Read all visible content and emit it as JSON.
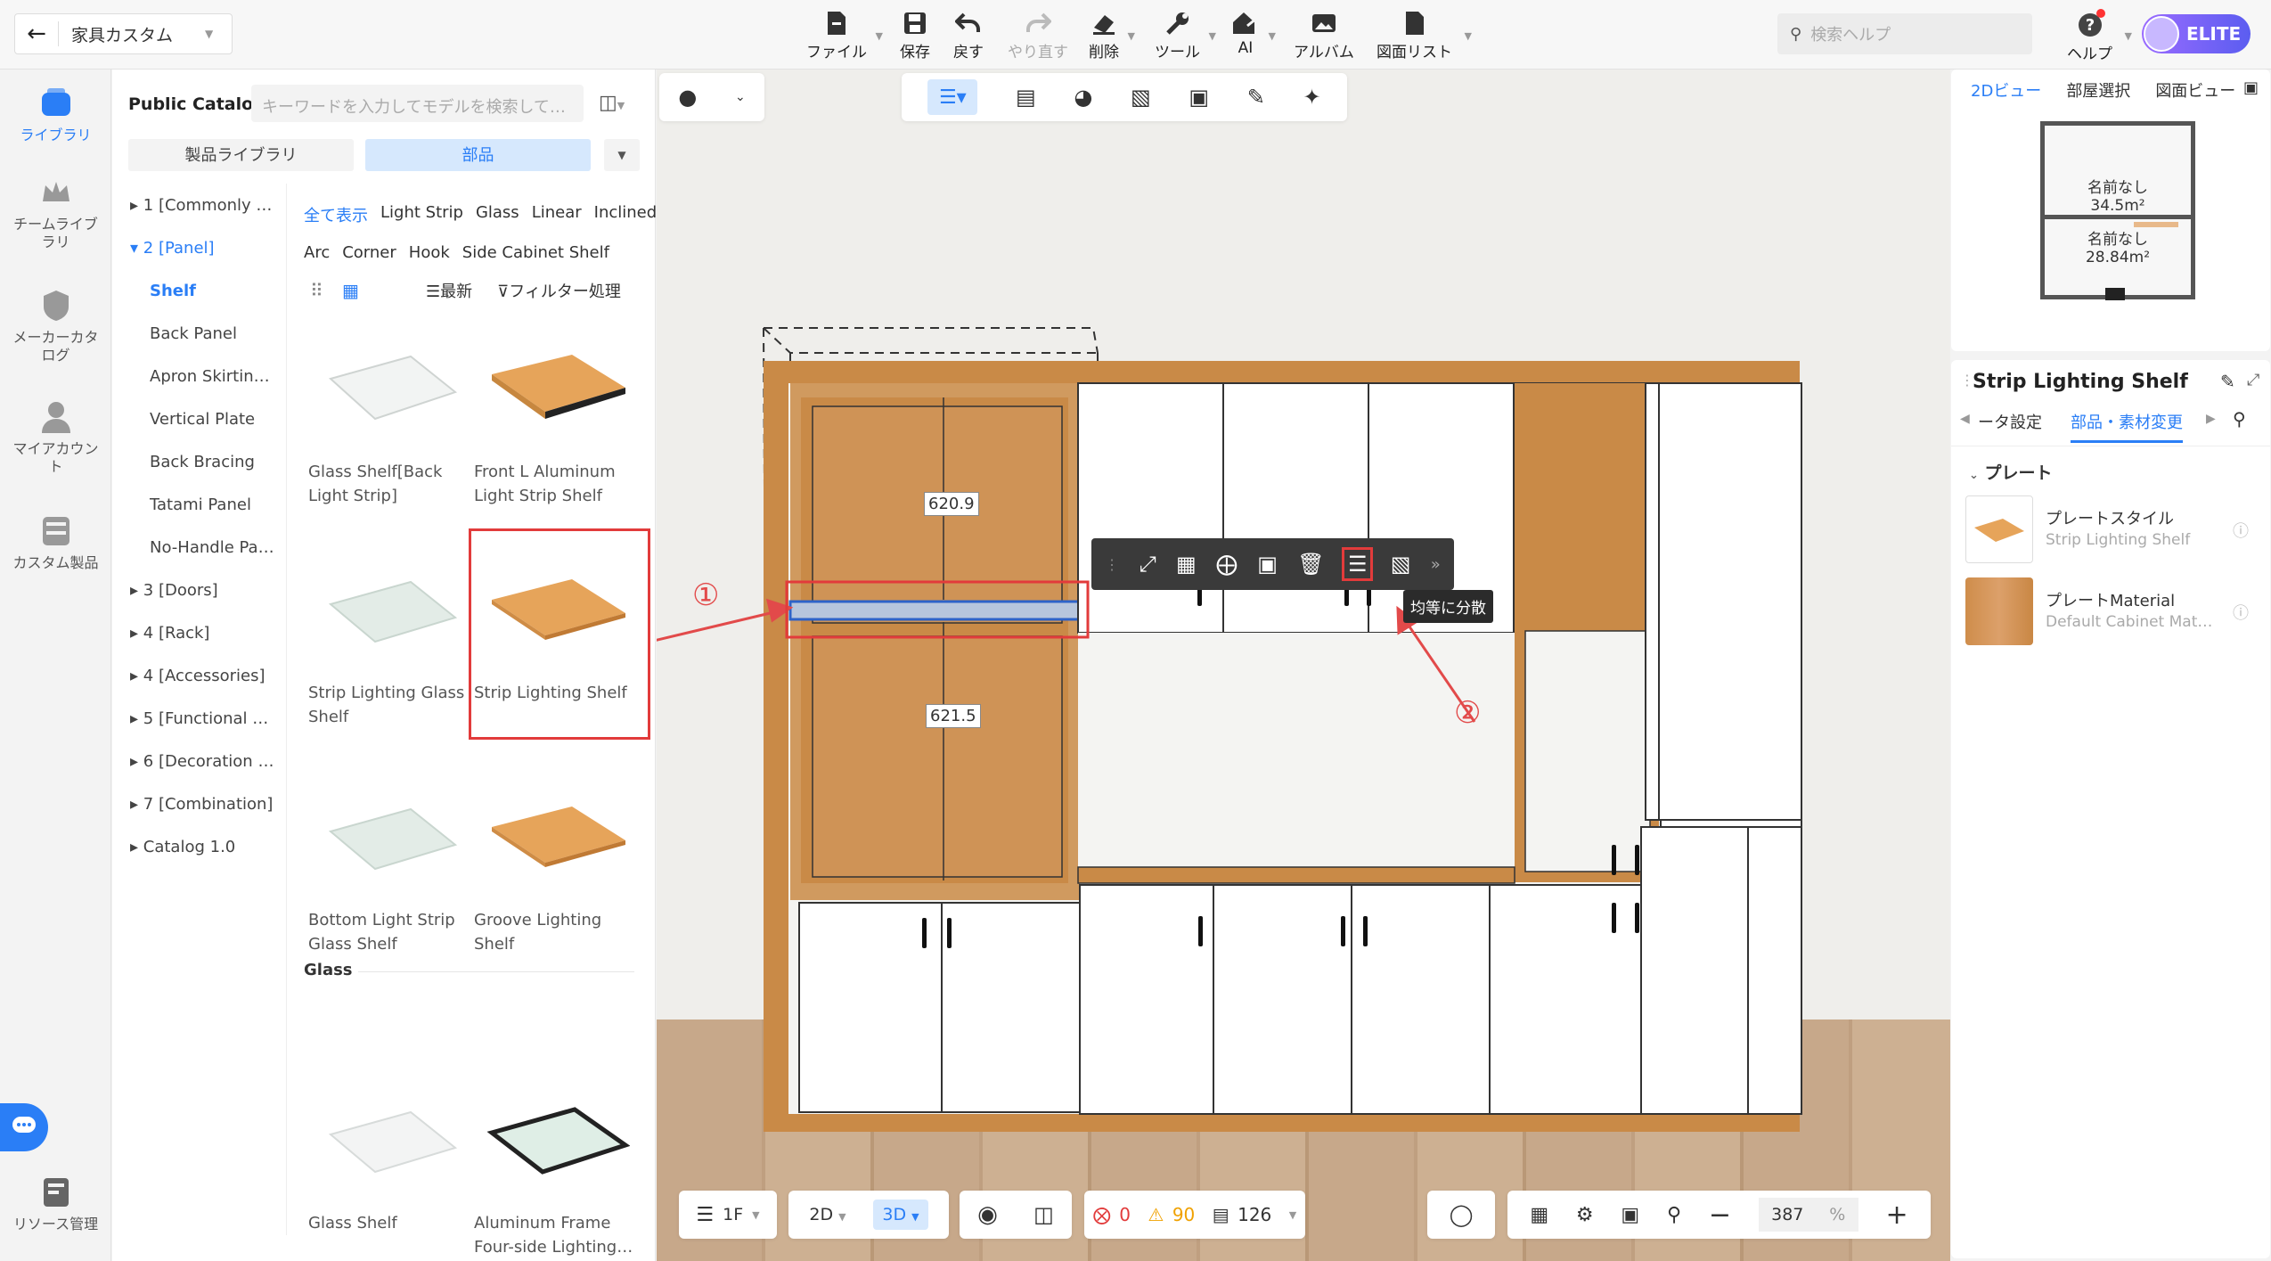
{
  "header": {
    "project_name": "家具カスタム",
    "toolbar": [
      {
        "label": "ファイル",
        "icon": "file-icon",
        "has_dropdown": true
      },
      {
        "label": "保存",
        "icon": "save-icon"
      },
      {
        "label": "戻す",
        "icon": "undo-icon"
      },
      {
        "label": "やり直す",
        "icon": "redo-icon",
        "disabled": true
      },
      {
        "label": "削除",
        "icon": "eraser-icon",
        "has_dropdown": true
      },
      {
        "label": "ツール",
        "icon": "wrench-icon",
        "has_dropdown": true
      },
      {
        "label": "AI",
        "icon": "ai-house-icon",
        "has_dropdown": true
      },
      {
        "label": "アルバム",
        "icon": "album-icon"
      },
      {
        "label": "図面リスト",
        "icon": "drawing-list-icon",
        "has_dropdown": true
      }
    ],
    "search_placeholder": "検索ヘルプ",
    "help_label": "ヘルプ",
    "badge": "ELITE"
  },
  "rail": [
    {
      "label": "ライブラリ",
      "active": true
    },
    {
      "label": "チームライブラリ"
    },
    {
      "label": "メーカーカタログ"
    },
    {
      "label": "マイアカウント"
    },
    {
      "label": "カスタム製品"
    },
    {
      "label": "リソース管理"
    }
  ],
  "library": {
    "title": "Public Catalog",
    "search_placeholder": "キーワードを入力してモデルを検索して…",
    "tabs": [
      "製品ライブラリ",
      "部品"
    ],
    "active_tab": 1,
    "tree": [
      {
        "label": "1 [Commonly …",
        "type": "group"
      },
      {
        "label": "2 [Panel]",
        "type": "group",
        "expanded": true
      },
      {
        "label": "Shelf",
        "type": "sub",
        "active": true
      },
      {
        "label": "Back Panel",
        "type": "sub"
      },
      {
        "label": "Apron Skirtin…",
        "type": "sub"
      },
      {
        "label": "Vertical Plate",
        "type": "sub"
      },
      {
        "label": "Back Bracing",
        "type": "sub"
      },
      {
        "label": "Tatami Panel",
        "type": "sub"
      },
      {
        "label": "No-Handle Pa…",
        "type": "sub"
      },
      {
        "label": "3 [Doors]",
        "type": "group"
      },
      {
        "label": "4 [Rack]",
        "type": "group"
      },
      {
        "label": "4 [Accessories]",
        "type": "group"
      },
      {
        "label": "5 [Functional …",
        "type": "group"
      },
      {
        "label": "6 [Decoration …",
        "type": "group"
      },
      {
        "label": "7 [Combination]",
        "type": "group"
      },
      {
        "label": "Catalog 1.0",
        "type": "group"
      }
    ],
    "filters_row1": [
      "全て表示",
      "Light Strip",
      "Glass",
      "Linear",
      "Inclined"
    ],
    "filters_row2": [
      "Arc",
      "Corner",
      "Hook",
      "Side Cabinet Shelf"
    ],
    "sort_label": "最新",
    "filter_label": "フィルター処理",
    "items": [
      {
        "label": "Glass Shelf[Back Light Strip]"
      },
      {
        "label": "Front L Aluminum Light Strip Shelf"
      },
      {
        "label": "Strip Lighting Glass Shelf"
      },
      {
        "label": "Strip Lighting Shelf",
        "selected": true
      },
      {
        "label": "Bottom Light Strip Glass Shelf"
      },
      {
        "label": "Groove Lighting Shelf"
      }
    ],
    "section_glass": "Glass",
    "glass_items": [
      {
        "label": "Glass Shelf"
      },
      {
        "label": "Aluminum Frame Four-side Lighting…"
      }
    ]
  },
  "canvas": {
    "dim_top": "620.9",
    "dim_bottom": "621.5",
    "annotation_1": "①",
    "annotation_2": "②",
    "tooltip": "均等に分散",
    "bottom": {
      "floor": "1F",
      "view_2d": "2D",
      "view_3d": "3D",
      "errors": "0",
      "warnings": "90",
      "count": "126",
      "zoom": "387",
      "zoom_unit": "%"
    }
  },
  "right": {
    "tabs": [
      "2Dビュー",
      "部屋選択",
      "図面ビュー"
    ],
    "rooms": [
      {
        "name": "名前なし",
        "area": "34.5m²"
      },
      {
        "name": "名前なし",
        "area": "28.84m²"
      }
    ],
    "props_title": "Strip Lighting Shelf",
    "prop_tabs": [
      "ータ設定",
      "部品・素材変更"
    ],
    "section": "プレート",
    "rows": [
      {
        "title": "プレートスタイル",
        "sub": "Strip Lighting Shelf"
      },
      {
        "title": "プレートMaterial",
        "sub": "Default Cabinet Mat…"
      }
    ]
  },
  "colors": {
    "accent": "#2a7ef6",
    "wood": "#c98a47",
    "highlight": "#e23b3b",
    "elite": "#7a5cf5"
  }
}
